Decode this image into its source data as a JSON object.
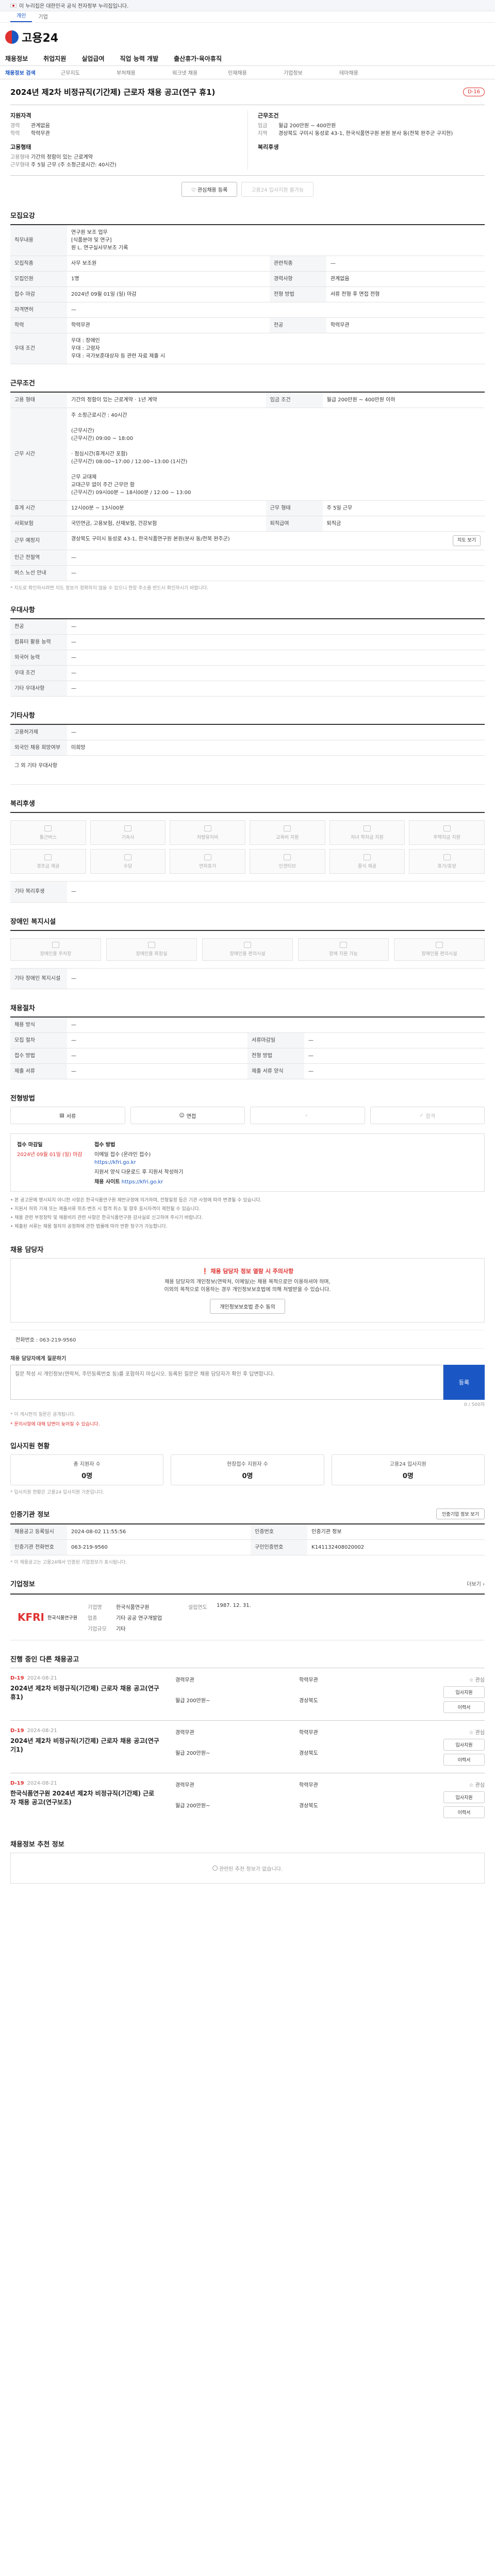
{
  "gov_banner": "이 누리집은 대한민국 공식 전자정부 누리집입니다.",
  "site_tabs": [
    "개인",
    "기업"
  ],
  "brand": "고용24",
  "gnb": [
    "채용정보",
    "취업지원",
    "실업급여",
    "직업 능력 개발",
    "출산휴가·육아휴직"
  ],
  "subnav": [
    "채용정보 검색",
    "근무지도",
    "부처채용",
    "워크넷 채용",
    "인재채용",
    "기업정보",
    "테마채용"
  ],
  "job_title": "2024년 제2차 비정규직(기간제) 근로자 채용 공고(연구 휴1)",
  "dday": "D-16",
  "summary": {
    "qual": {
      "head": "지원자격",
      "rows": [
        {
          "k": "경력",
          "v": "관계없음"
        },
        {
          "k": "학력",
          "v": "학력무관"
        }
      ]
    },
    "cond": {
      "head": "근무조건",
      "rows": [
        {
          "k": "임금",
          "v": "월급 200만원 ~ 400만원"
        },
        {
          "k": "지역",
          "v": "경상북도 구미시 동성로 43-1, 한국식품연구원 본원 분사 동(전북 완주군 구지현)"
        }
      ]
    },
    "form": {
      "head": "고용형태",
      "rows": [
        {
          "k": "고용형태",
          "v": "기간의 정함이 있는 근로계약"
        },
        {
          "k": "근무형태",
          "v": "주 5일 근무 (주 소정근로시간: 40시간)"
        }
      ]
    },
    "welfare": {
      "head": "복리후생",
      "rows": []
    }
  },
  "buttons": {
    "scrap": "관심채용 등록",
    "apply": "고용24 입사지원 불가능"
  },
  "recruit": {
    "title": "모집요강",
    "rows": [
      {
        "k": "직무내용",
        "v": "연구원 보조 업무\n[식품분야 및 연구]\n원 L. 연구실사무보조 기록"
      },
      {
        "k": "모집직종",
        "v": "사무 보조원",
        "k2": "관련직종",
        "v2": "—"
      },
      {
        "k": "모집인원",
        "v": "1명",
        "k2": "경력사항",
        "v2": "관계없음"
      },
      {
        "k": "접수 마감",
        "v": "2024년 09월 01일 (일) 마감",
        "k2": "전형 방법",
        "v2": "서류 전형 후 면접 전형"
      },
      {
        "k": "자격면허",
        "v": "—",
        "k2": "",
        "v2": ""
      },
      {
        "k": "학력",
        "v": "학력무관",
        "k2": "전공",
        "v2": "학력무관"
      },
      {
        "k": "우대 조건",
        "v": "우대 : 장애인\n우대 : 고령자\n우대 : 국가보훈대상자 등 관련 자료 제출 시"
      }
    ]
  },
  "condition": {
    "title": "근무조건",
    "rows": [
      {
        "k": "고용 형태",
        "v": "기간의 정함이 있는 근로계약 · 1년 계약",
        "k2": "임금 조건",
        "v2": "월급 200만원 ~ 400만원 이하"
      },
      {
        "k": "근무 시간",
        "v": "주 소정근로시간 : 40시간\n\n(근무시간)\n(근무시간) 09:00 ~ 18:00\n\n· 점심시간(휴게시간 포함)\n(근무시간) 08:00~17:00 / 12:00~13:00 (1시간)\n\n근무 교대제\n교대근무 없이 주간 근무만 함\n(근무시간) 09시00분 ~ 18시00분 / 12:00 ~ 13:00"
      },
      {
        "k": "휴게 시간",
        "v": "12시00분 ~ 13시00분",
        "k2": "근무 형태",
        "v2": "주 5일 근무"
      },
      {
        "k": "사회보험",
        "v": "국민연금, 고용보험, 산재보험, 건강보험",
        "k2": "퇴직급여",
        "v2": "퇴직금"
      },
      {
        "k": "근무 예정지",
        "v": "경상북도 구미시 동성로 43-1, 한국식품연구원 본원(분사 동/전북 완주군)",
        "k2": "",
        "v2": ""
      },
      {
        "k": "인근 전철역",
        "v": "—",
        "k2": "",
        "v2": ""
      },
      {
        "k": "버스 노선 안내",
        "v": "—",
        "k2": "",
        "v2": ""
      }
    ],
    "map_btn": "지도 보기",
    "note": "* 지도로 확인하시려면 지도 정보가 정확하지 않을 수 있으니 현장 주소를 반드시 확인하시기 바랍니다."
  },
  "etc": {
    "title": "우대사항",
    "rows": [
      {
        "k": "전공",
        "v": "—"
      },
      {
        "k": "컴퓨터 활용 능력",
        "v": "—"
      },
      {
        "k": "외국어 능력",
        "v": "—"
      },
      {
        "k": "우대 조건",
        "v": "—"
      },
      {
        "k": "기타 우대사항",
        "v": "—"
      }
    ]
  },
  "other": {
    "title": "기타사항",
    "rows": [
      {
        "k": "고용허가제",
        "v": "—"
      },
      {
        "k": "외국인 채용 희망여부",
        "v": "미희망"
      }
    ],
    "extra": "그 외 기타 우대사항"
  },
  "welfare_sec": {
    "title": "복리후생",
    "items": [
      "통근버스",
      "기숙사",
      "차량유지비",
      "교육비 지원",
      "자녀 학자금 지원",
      "주택자금 지원",
      "경조금 제공",
      "수당",
      "연차휴가",
      "인센티브",
      "중식 제공",
      "휴가/휴양"
    ],
    "extra_label": "기타 복리후생",
    "extra_val": "—"
  },
  "disabled_sec": {
    "title": "장애인 복지시설",
    "items": [
      "장애인용 주차장",
      "장애인용 화장실",
      "장애인용 편의시설",
      "장애 지원 가능",
      "장애인용 편의시설"
    ],
    "extra_label": "기타 장애인 복지시설",
    "extra_val": "—"
  },
  "recruit_method": {
    "title": "채용절차",
    "rows": [
      {
        "k": "채용 방식",
        "v": "—",
        "k2": "",
        "v2": ""
      },
      {
        "k": "모집 절차",
        "v": "—",
        "k2": "서류마감일",
        "v2": "—"
      },
      {
        "k": "접수 방법",
        "v": "—",
        "k2": "전형 방법",
        "v2": "—"
      },
      {
        "k": "제출 서류",
        "v": "—",
        "k2": "제출 서류 양식",
        "v2": "—"
      }
    ]
  },
  "process": {
    "title": "전형방법",
    "steps": [
      "서류",
      "면접",
      "",
      "합격"
    ]
  },
  "apply": {
    "k1": "접수 마감일",
    "v1": "2024년 09월 01일 (일) 마감",
    "k2": "접수 방법",
    "v2": "이메일 접수 (온라인 접수)",
    "k3": "",
    "v3": "https://kfri.go.kr",
    "email": "지원서 양식 다운로드 후 지원서 작성하기",
    "note_k": "채용 사이트",
    "note_v": "https://kfri.go.kr"
  },
  "notes": [
    "• 본 공고문에 명시되지 아니한 사항은 한국식품연구원 제반규정에 의거하며, 전형일정 등은 기관 사정에 따라 변경될 수 있습니다.",
    "• 지원서 허위 기재 또는 제출서류 위조·변조 시 합격 취소 및 향후 응시자격이 제한될 수 있습니다.",
    "• 채용 관련 부정청탁 및 채용비리 관련 사항은 한국식품연구원 감사실로 신고하여 주시기 바랍니다.",
    "• 제출된 서류는 채용 절차의 공정화에 관한 법률에 따라 반환 청구가 가능합니다."
  ],
  "contact": {
    "title": "채용 담당자",
    "notice_title": "채용 담당자 정보 열람 시 주의사항",
    "notice_lines": [
      "채용 담당자의 개인정보(연락처, 이메일)는 채용 목적으로만 이용하셔야 하며,",
      "이외의 목적으로 이용하는 경우 개인정보보호법에 의해 처벌받을 수 있습니다."
    ],
    "reveal_btn": "개인정보보호법 준수 동의",
    "phone_label": "전화번호",
    "phone": "063-219-9560"
  },
  "qna": {
    "title": "채용 담당자에게 질문하기",
    "placeholder": "질문 작성 시 개인정보(연락처, 주민등록번호 등)를 포함하지 마십시오. 등록된 질문은 채용 담당자가 확인 후 답변합니다.",
    "count": "0 / 500자",
    "send": "등록",
    "note1": "* 이 게시판의 질문은 공개됩니다.",
    "note2": "* 문의사항에 대해 답변이 늦어질 수 있습니다."
  },
  "stats": {
    "title": "입사지원 현황",
    "items": [
      {
        "label": "총 지원자 수",
        "value": "0명"
      },
      {
        "label": "현장접수 지원자 수",
        "value": "0명"
      },
      {
        "label": "고용24 입사지원",
        "value": "0명"
      }
    ],
    "note": "* 입사지원 현황은 고용24 입사지원 기준입니다."
  },
  "info": {
    "title": "인증기관 정보",
    "btn": "인증기업 정보 보기",
    "rows": [
      {
        "k": "채용공고 등록일시",
        "v": "2024-08-02 11:55:56",
        "k2": "인증번호",
        "v2": "인증기관 정보"
      },
      {
        "k": "인증기관 전화번호",
        "v": "063-219-9560",
        "k2": "구인인증번호",
        "v2": "K141132408020002"
      }
    ],
    "note": "* 이 채용공고는 고용24에서 인증된 기업정보가 표시됩니다."
  },
  "org": {
    "title": "기업정보",
    "more": "더보기",
    "logo": "KFRI",
    "logo_sub": "한국식품연구원",
    "rows": [
      {
        "k": "기업명",
        "v": "한국식품연구원",
        "k2": "설립연도",
        "v2": "1987. 12. 31."
      },
      {
        "k": "업종",
        "v": "기타 공공 연구개발업",
        "k2": "",
        "v2": ""
      },
      {
        "k": "기업규모",
        "v": "기타",
        "k2": "",
        "v2": ""
      }
    ]
  },
  "related": {
    "title": "진행 중인 다른 채용공고",
    "jobs": [
      {
        "dd": "D-19",
        "date": "2024-08-21",
        "t": "2024년 제2차 비정규직(기간제) 근로자 채용 공고(연구 휴1)",
        "m": [
          "경력무관",
          "학력무관",
          "월급 200만원~",
          "경상북도"
        ]
      },
      {
        "dd": "D-19",
        "date": "2024-08-21",
        "t": "2024년 제2차 비정규직(기간제) 근로자 채용 공고(연구 기1)",
        "m": [
          "경력무관",
          "학력무관",
          "월급 200만원~",
          "경상북도"
        ]
      },
      {
        "dd": "D-19",
        "date": "2024-08-21",
        "t": "한국식품연구원 2024년 제2차 비정규직(기간제) 근로자 채용 공고(연구보조)",
        "m": [
          "경력무관",
          "학력무관",
          "월급 200만원~",
          "경상북도"
        ]
      }
    ],
    "bm": "관심",
    "sb1": "입사지원",
    "sb2": "이력서"
  },
  "recommend": {
    "title": "채용정보 추천 정보",
    "empty": "관련된 추천 정보가 없습니다."
  }
}
